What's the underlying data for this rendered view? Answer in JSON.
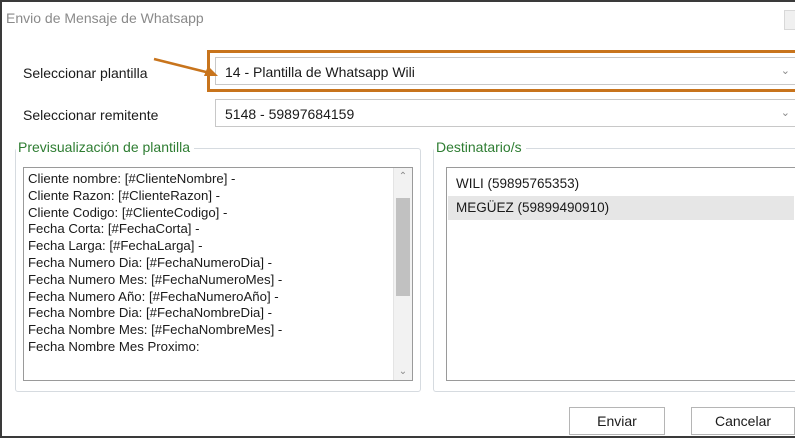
{
  "window": {
    "title": "Envio de Mensaje de Whatsapp"
  },
  "template": {
    "label": "Seleccionar plantilla",
    "value": "14 - Plantilla de Whatsapp Wili",
    "highlight_color": "#c8741c"
  },
  "sender": {
    "label": "Seleccionar remitente",
    "value": "5148 - 59897684159"
  },
  "preview": {
    "title": "Previsualización de plantilla",
    "lines": [
      "Cliente nombre: [#ClienteNombre] -",
      "Cliente Razon: [#ClienteRazon] -",
      "Cliente Codigo: [#ClienteCodigo] -",
      "Fecha Corta: [#FechaCorta] -",
      "Fecha Larga: [#FechaLarga] -",
      "Fecha Numero Dia: [#FechaNumeroDia] -",
      "Fecha Numero Mes: [#FechaNumeroMes] -",
      "Fecha Numero Año: [#FechaNumeroAño] -",
      "Fecha Nombre Dia: [#FechaNombreDia] -",
      "Fecha Nombre Mes: [#FechaNombreMes] -",
      "Fecha Nombre Mes Proximo:"
    ]
  },
  "recipients": {
    "title": "Destinatario/s",
    "items": [
      {
        "label": "WILI (59895765353)",
        "selected": false
      },
      {
        "label": "MEGÜEZ (59899490910)",
        "selected": true
      }
    ]
  },
  "actions": {
    "send_label": "Enviar",
    "cancel_label": "Cancelar"
  },
  "colors": {
    "group_title": "#2e7d32",
    "title_text": "#8a8a8a"
  }
}
